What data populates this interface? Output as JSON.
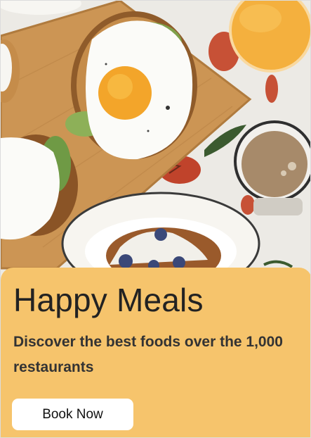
{
  "card": {
    "title": "Happy Meals",
    "subtitle": "Discover the best foods over the 1,000 restaurants",
    "button_label": "Book Now"
  },
  "hero_image": {
    "subject": "breakfast-table-photo"
  },
  "colors": {
    "card_background": "#f6c46c",
    "button_background": "#ffffff",
    "title_text": "#222222"
  }
}
